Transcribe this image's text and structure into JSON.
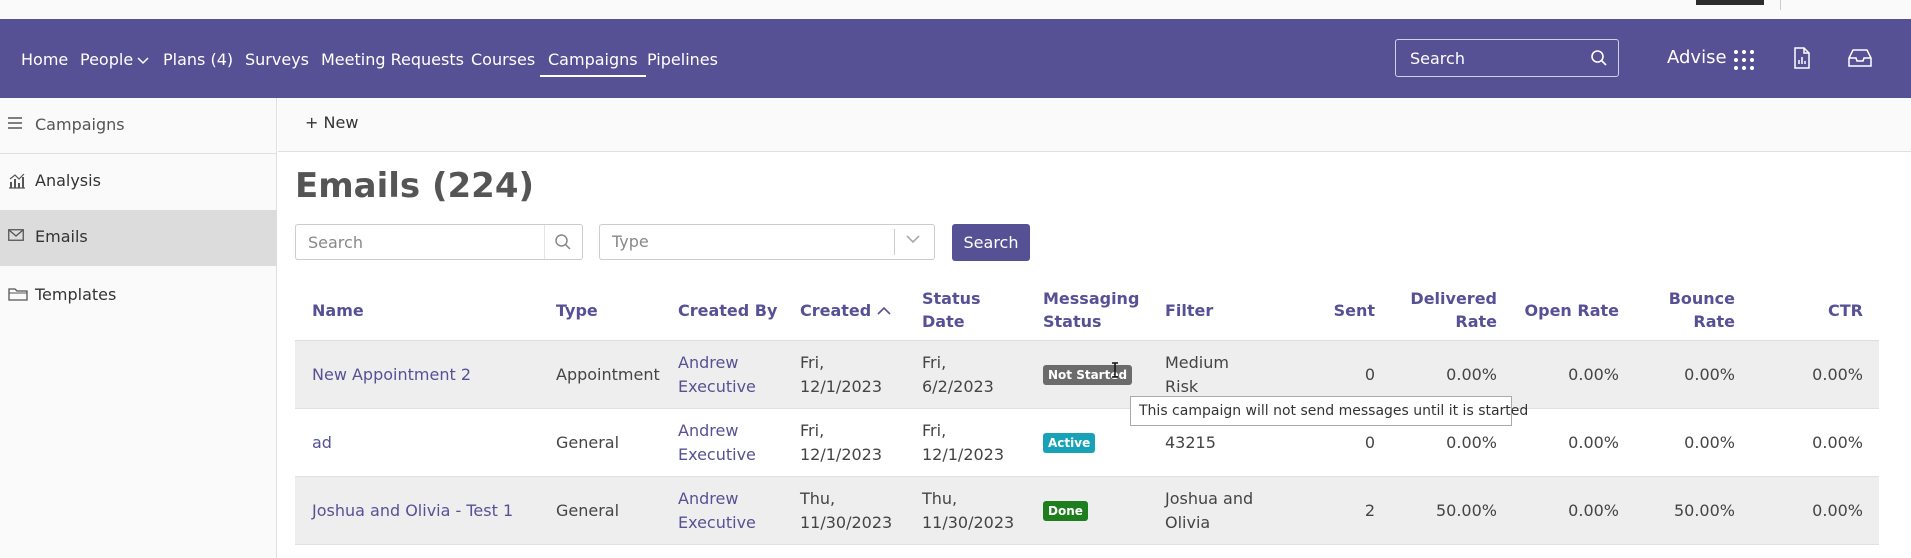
{
  "nav": {
    "items": [
      {
        "label": "Home"
      },
      {
        "label": "People"
      },
      {
        "label": "Plans (4)"
      },
      {
        "label": "Surveys"
      },
      {
        "label": "Meeting Requests"
      },
      {
        "label": "Courses"
      },
      {
        "label": "Campaigns"
      },
      {
        "label": "Pipelines"
      }
    ],
    "search_placeholder": "Search",
    "brand_label": "Advise"
  },
  "sidebar": {
    "items": [
      {
        "label": "Campaigns"
      },
      {
        "label": "Analysis"
      },
      {
        "label": "Emails"
      },
      {
        "label": "Templates"
      }
    ]
  },
  "toolbar": {
    "new_label": "New"
  },
  "page": {
    "title": "Emails (224)"
  },
  "filters": {
    "search_placeholder": "Search",
    "type_placeholder": "Type",
    "search_button": "Search"
  },
  "table": {
    "headers": {
      "name": "Name",
      "type": "Type",
      "created_by": "Created By",
      "created": "Created",
      "status_date": "Status Date",
      "messaging_status": "Messaging Status",
      "filter": "Filter",
      "sent": "Sent",
      "delivered_rate": "Delivered Rate",
      "open_rate": "Open Rate",
      "bounce_rate": "Bounce Rate",
      "ctr": "CTR"
    },
    "rows": [
      {
        "name": "New Appointment 2",
        "type": "Appointment",
        "created_by": "Andrew Executive",
        "created": "Fri, 12/1/2023",
        "status_date": "Fri, 6/2/2023",
        "status": "Not Started",
        "status_color": "#6b6b6b",
        "filter": "Medium Risk",
        "sent": "0",
        "delivered_rate": "0.00%",
        "open_rate": "0.00%",
        "bounce_rate": "0.00%",
        "ctr": "0.00%"
      },
      {
        "name": "ad",
        "type": "General",
        "created_by": "Andrew Executive",
        "created": "Fri, 12/1/2023",
        "status_date": "Fri, 12/1/2023",
        "status": "Active",
        "status_color": "#17a2b8",
        "filter": "43215",
        "sent": "0",
        "delivered_rate": "0.00%",
        "open_rate": "0.00%",
        "bounce_rate": "0.00%",
        "ctr": "0.00%"
      },
      {
        "name": "Joshua and Olivia - Test 1",
        "type": "General",
        "created_by": "Andrew Executive",
        "created": "Thu, 11/30/2023",
        "status_date": "Thu, 11/30/2023",
        "status": "Done",
        "status_color": "#1e7e1e",
        "filter": "Joshua and Olivia",
        "sent": "2",
        "delivered_rate": "50.00%",
        "open_rate": "0.00%",
        "bounce_rate": "50.00%",
        "ctr": "0.00%"
      }
    ]
  },
  "tooltip": {
    "text": "This campaign will not send messages until it is started"
  },
  "colors": {
    "brand": "#565195",
    "row_stripe": "#eeeeee",
    "sidebar_selected": "#dcdcdc"
  }
}
